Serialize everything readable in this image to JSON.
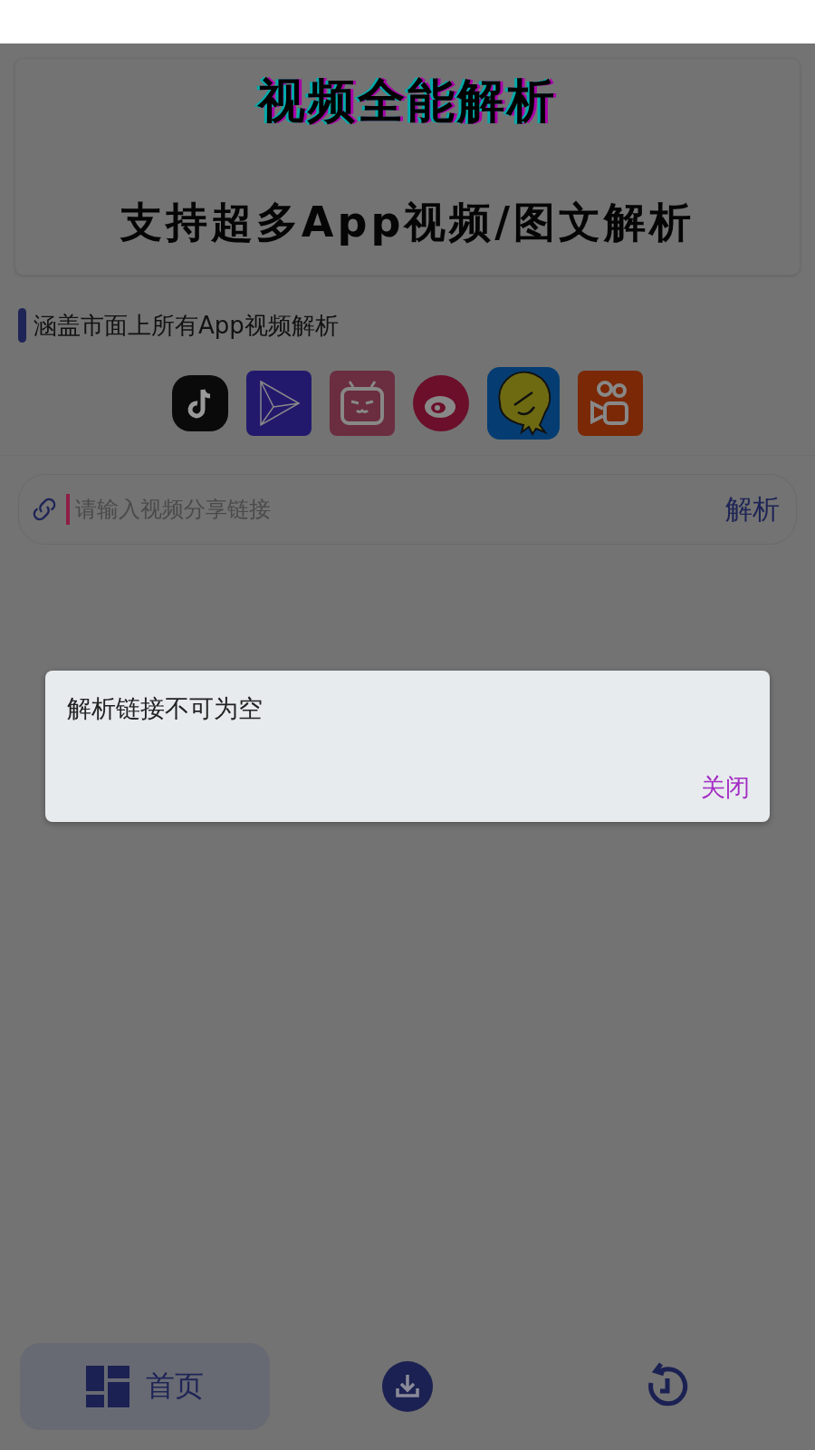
{
  "banner": {
    "title": "视频全能解析",
    "subtitle": "支持超多App视频/图文解析"
  },
  "section_heading": "涵盖市面上所有App视频解析",
  "search": {
    "placeholder": "请输入视频分享链接",
    "submit": "解析"
  },
  "dialog": {
    "message": "解析链接不可为空",
    "close": "关闭"
  },
  "nav": [
    {
      "kind": "home",
      "label": "首页",
      "selected": true
    },
    {
      "kind": "download",
      "selected": false
    },
    {
      "kind": "history",
      "selected": false
    }
  ]
}
